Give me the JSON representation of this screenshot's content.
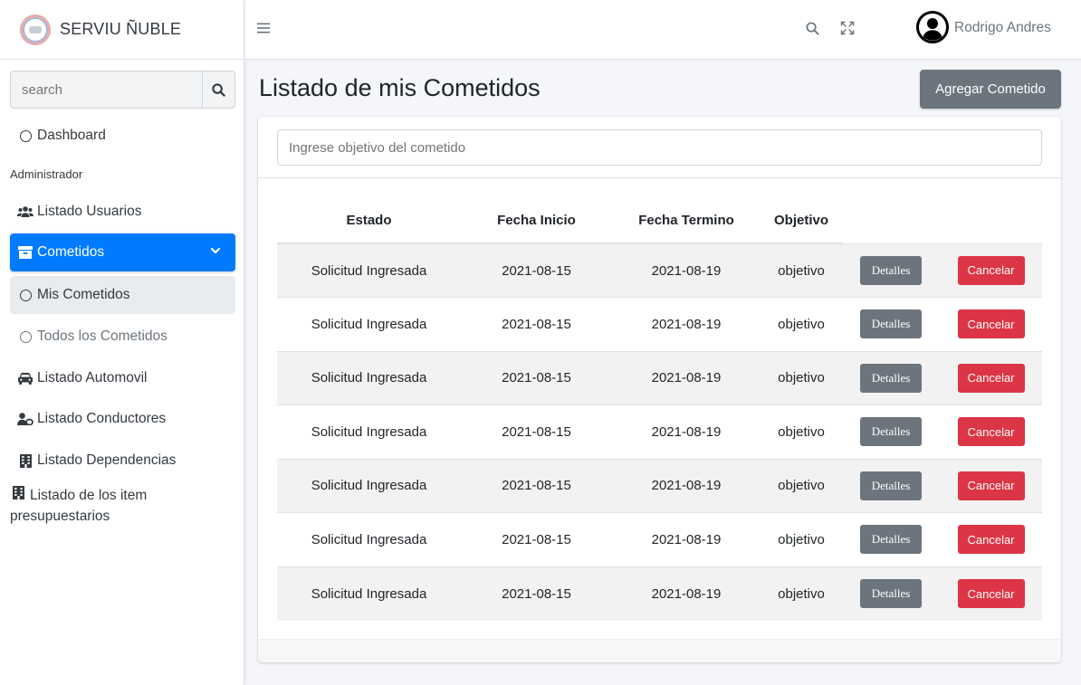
{
  "brand": {
    "name_bold": "SERVIU",
    "name_rest": " ÑUBLE"
  },
  "sidebar": {
    "search_placeholder": "search",
    "items": [
      {
        "label": "Dashboard",
        "icon": "circle-icon"
      },
      {
        "header": "Administrador"
      },
      {
        "label": "Listado Usuarios",
        "icon": "users-icon"
      },
      {
        "label": "Cometidos",
        "icon": "archive-icon"
      },
      {
        "label": "Mis Cometidos",
        "icon": "circle-icon"
      },
      {
        "label": "Todos los Cometidos",
        "icon": "circle-icon"
      },
      {
        "label": "Listado Automovil",
        "icon": "car-icon"
      },
      {
        "label": "Listado Conductores",
        "icon": "user-tie-icon"
      },
      {
        "label": "Listado Dependencias",
        "icon": "building-icon"
      },
      {
        "label_line1": "Listado de los item",
        "label_line2": "presupuestarios",
        "icon": "building-icon"
      }
    ]
  },
  "topbar": {
    "user_name": "Rodrigo Andres"
  },
  "main": {
    "title": "Listado de mis Cometidos",
    "add_button": "Agregar Cometido",
    "filter_placeholder": "Ingrese objetivo del cometido",
    "table": {
      "headers": [
        "Estado",
        "Fecha Inicio",
        "Fecha Termino",
        "Objetivo"
      ],
      "details_label": "Detalles",
      "cancel_label": "Cancelar",
      "rows": [
        {
          "estado": "Solicitud Ingresada",
          "inicio": "2021-08-15",
          "termino": "2021-08-19",
          "objetivo": "objetivo"
        },
        {
          "estado": "Solicitud Ingresada",
          "inicio": "2021-08-15",
          "termino": "2021-08-19",
          "objetivo": "objetivo"
        },
        {
          "estado": "Solicitud Ingresada",
          "inicio": "2021-08-15",
          "termino": "2021-08-19",
          "objetivo": "objetivo"
        },
        {
          "estado": "Solicitud Ingresada",
          "inicio": "2021-08-15",
          "termino": "2021-08-19",
          "objetivo": "objetivo"
        },
        {
          "estado": "Solicitud Ingresada",
          "inicio": "2021-08-15",
          "termino": "2021-08-19",
          "objetivo": "objetivo"
        },
        {
          "estado": "Solicitud Ingresada",
          "inicio": "2021-08-15",
          "termino": "2021-08-19",
          "objetivo": "objetivo"
        },
        {
          "estado": "Solicitud Ingresada",
          "inicio": "2021-08-15",
          "termino": "2021-08-19",
          "objetivo": "objetivo"
        }
      ]
    }
  },
  "colors": {
    "primary": "#007bff",
    "secondary": "#6c757d",
    "danger": "#dc3545"
  }
}
